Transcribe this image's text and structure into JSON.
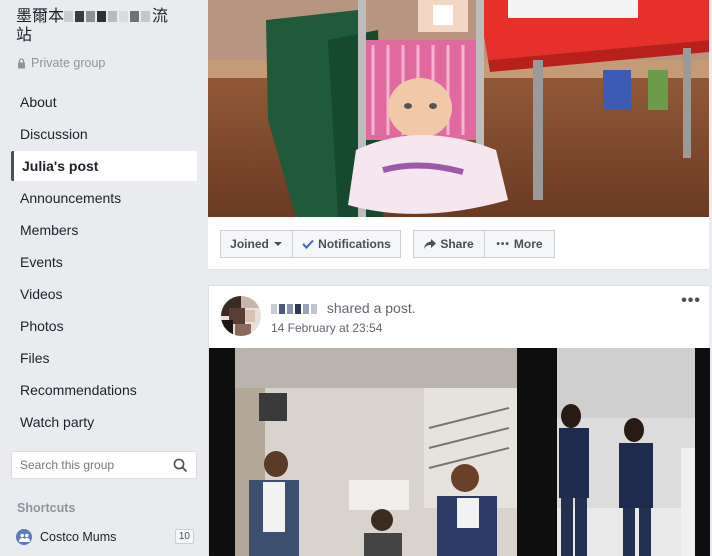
{
  "group": {
    "name_visible": "墨爾本",
    "name_tail": "流",
    "name_line2": "站",
    "privacy": "Private group"
  },
  "nav": [
    {
      "label": "About"
    },
    {
      "label": "Discussion"
    },
    {
      "label": "Julia's post",
      "active": true
    },
    {
      "label": "Announcements"
    },
    {
      "label": "Members"
    },
    {
      "label": "Events"
    },
    {
      "label": "Videos"
    },
    {
      "label": "Photos"
    },
    {
      "label": "Files"
    },
    {
      "label": "Recommendations"
    },
    {
      "label": "Watch party"
    }
  ],
  "search": {
    "placeholder": "Search this group"
  },
  "shortcuts": {
    "title": "Shortcuts",
    "items": [
      {
        "label": "Costco Mums",
        "count": "10"
      }
    ]
  },
  "actions": {
    "joined": "Joined",
    "notifications": "Notifications",
    "share": "Share",
    "more": "More"
  },
  "post": {
    "action": "shared a post.",
    "time": "14 February at 23:54",
    "more_glyph": "•••"
  },
  "colors": {
    "background": "#e9ebee",
    "card": "#ffffff",
    "text": "#1d2129",
    "muted": "#90949c",
    "button_bg": "#f5f6f7",
    "icon_blue": "#5b7bc0"
  },
  "icons": {
    "lock": "lock-icon",
    "search": "search-icon",
    "group": "group-icon",
    "caret": "chevron-down-icon",
    "check": "checkmark-icon",
    "share": "share-arrow-icon",
    "more": "more-dots-icon",
    "globe": "globe-icon"
  }
}
